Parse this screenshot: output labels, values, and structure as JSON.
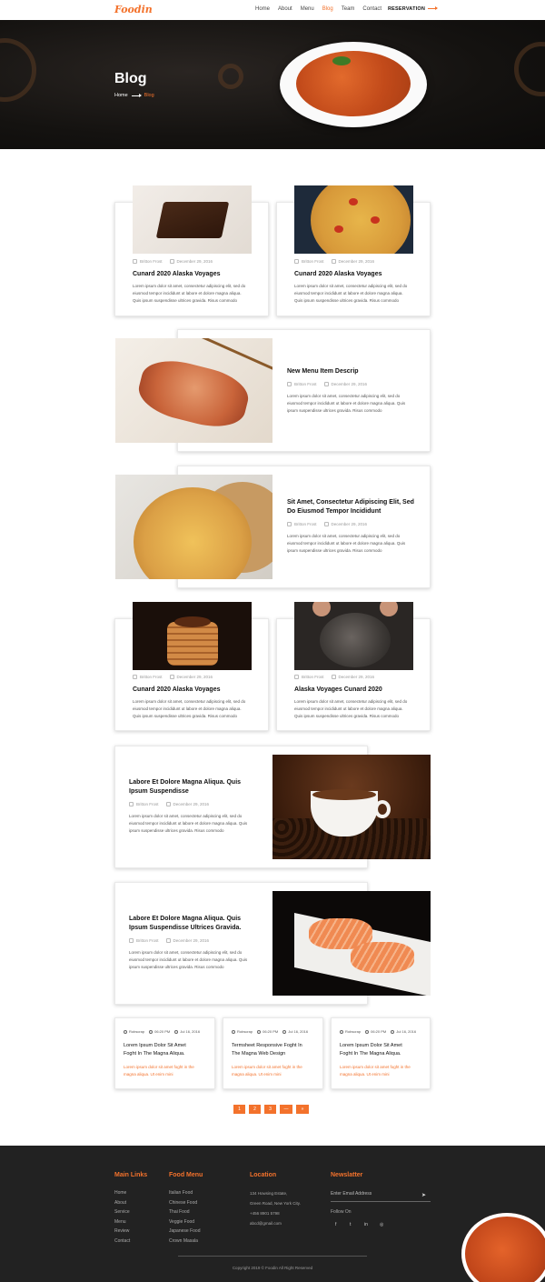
{
  "nav": {
    "logo": "Foodin",
    "items": [
      "Home",
      "About",
      "Menu",
      "Blog",
      "Team",
      "Contact"
    ],
    "active": "Blog",
    "reservation": "RESERVATION"
  },
  "hero": {
    "title": "Blog",
    "crumb_home": "Home",
    "crumb_current": "Blog"
  },
  "posts": [
    {
      "author": "Britton Frost",
      "date": "December 29, 2016",
      "title": "Cunard 2020 Alaska Voyages",
      "text": [
        "Lorem ipsum dolor sit amet, consectetur adipiscing elit, sed do",
        "eiusmod tempor incididunt ut labore et dolore magna aliqua.",
        "Quis ipsum suspendisse ultrices gravida. Risus commodo"
      ]
    },
    {
      "author": "Britton Frost",
      "date": "December 29, 2016",
      "title": "Cunard 2020 Alaska Voyages",
      "text": [
        "Lorem ipsum dolor sit amet, consectetur adipiscing elit, sed do",
        "eiusmod tempor incididunt ut labore et dolore magna aliqua.",
        "Quis ipsum suspendisse ultrices gravida. Risus commodo"
      ]
    },
    {
      "author": "Britton Frost",
      "date": "December 29, 2016",
      "title": "New Menu Item Descrip",
      "text": [
        "Lorem ipsum dolor sit amet, consectetur adipiscing elit, sed do",
        "eiusmod tempor incididunt ut labore et dolore magna aliqua. Quis",
        "ipsum suspendisse ultrices gravida. Risus commodo"
      ]
    },
    {
      "author": "Britton Frost",
      "date": "December 29, 2016",
      "title_lines": [
        "Sit Amet, Consectetur Adipiscing Elit, Sed",
        "Do Eiusmod Tempor Incididunt"
      ],
      "text": [
        "Lorem ipsum dolor sit amet, consectetur adipiscing elit, sed do",
        "eiusmod tempor incididunt ut labore et dolore magna aliqua. Quis",
        "ipsum suspendisse ultrices gravida. Risus commodo"
      ]
    },
    {
      "author": "Britton Frost",
      "date": "December 29, 2016",
      "title": "Cunard 2020 Alaska Voyages",
      "text": [
        "Lorem ipsum dolor sit amet, consectetur adipiscing elit, sed do",
        "eiusmod tempor incididunt ut labore et dolore magna aliqua.",
        "Quis ipsum suspendisse ultrices gravida. Risus commodo"
      ]
    },
    {
      "author": "Britton Frost",
      "date": "December 29, 2016",
      "title": "Alaska Voyages Cunard 2020",
      "text": [
        "Lorem ipsum dolor sit amet, consectetur adipiscing elit, sed do",
        "eiusmod tempor incididunt ut labore et dolore magna aliqua.",
        "Quis ipsum suspendisse ultrices gravida. Risus commodo"
      ]
    },
    {
      "author": "Britton Frost",
      "date": "December 29, 2016",
      "title_lines": [
        "Labore Et Dolore Magna Aliqua. Quis",
        "Ipsum Suspendisse"
      ],
      "text": [
        "Lorem ipsum dolor sit amet, consectetur adipiscing elit, sed do",
        "eiusmod tempor incididunt ut labore et dolore magna aliqua. Quis",
        "ipsum suspendisse ultrices gravida. Risus commodo"
      ]
    },
    {
      "author": "Britton Frost",
      "date": "December 29, 2016",
      "title_lines": [
        "Labore Et Dolore Magna Aliqua. Quis",
        "Ipsum Suspendisse Ultrices Gravida."
      ],
      "text": [
        "Lorem ipsum dolor sit amet, consectetur adipiscing elit, sed do",
        "eiusmod tempor incididunt ut labore et dolore magna aliqua. Quis",
        "ipsum suspendisse ultrices gravida. Risus commodo"
      ]
    }
  ],
  "small_posts": [
    {
      "author": "Robscrap",
      "time": "06:20 PM",
      "date": "Jul 16, 2016",
      "title": [
        "Lorem Ipsum Dolor Sit Amet",
        "Foght In The Magna Aliqua."
      ],
      "text": [
        "Lorem ipsum dolor sit amet foght in the",
        "magna aliqua. Ut enim mini"
      ]
    },
    {
      "author": "Robscrap",
      "time": "06:20 PM",
      "date": "Jul 16, 2016",
      "title": [
        "Termsheet Responsive Foght In",
        "The Magna Web Design"
      ],
      "text": [
        "Lorem ipsum dolor sit amet foght in the",
        "magna aliqua. Ut enim mini"
      ]
    },
    {
      "author": "Robscrap",
      "time": "06:20 PM",
      "date": "Jul 16, 2016",
      "title": [
        "Lorem Ipsum Dolor Sit Amet",
        "Foght In The Magna Aliqua."
      ],
      "text": [
        "Lorem ipsum dolor sit amet foght in the",
        "magna aliqua. Ut enim mini"
      ]
    }
  ],
  "pagination": [
    "1",
    "2",
    "3",
    "—",
    "»"
  ],
  "footer": {
    "main_links_title": "Main Links",
    "main_links": [
      "Home",
      "About",
      "Service",
      "Menu",
      "Review",
      "Contact"
    ],
    "food_menu_title": "Food Menu",
    "food_menu": [
      "Italian Food",
      "Chinese Food",
      "Thai Food",
      "Veggie Food",
      "Japanese Food",
      "Crown Masala"
    ],
    "location_title": "Location",
    "location": [
      "134 Howsing Estate,",
      "Green Road, New York City.",
      "+456 8901 5798",
      "abcd@gmail.com"
    ],
    "newsletter_title": "Newslatter",
    "email_placeholder": "Enter Email Address",
    "follow": "Follow On",
    "social": [
      "f",
      "t",
      "in",
      "◎"
    ],
    "copyright": "Copyright 2019 © Foodin All Right Reserved"
  },
  "colors": {
    "accent": "#f3722c",
    "footer_bg": "#222222",
    "hero_bg": "#141210"
  }
}
